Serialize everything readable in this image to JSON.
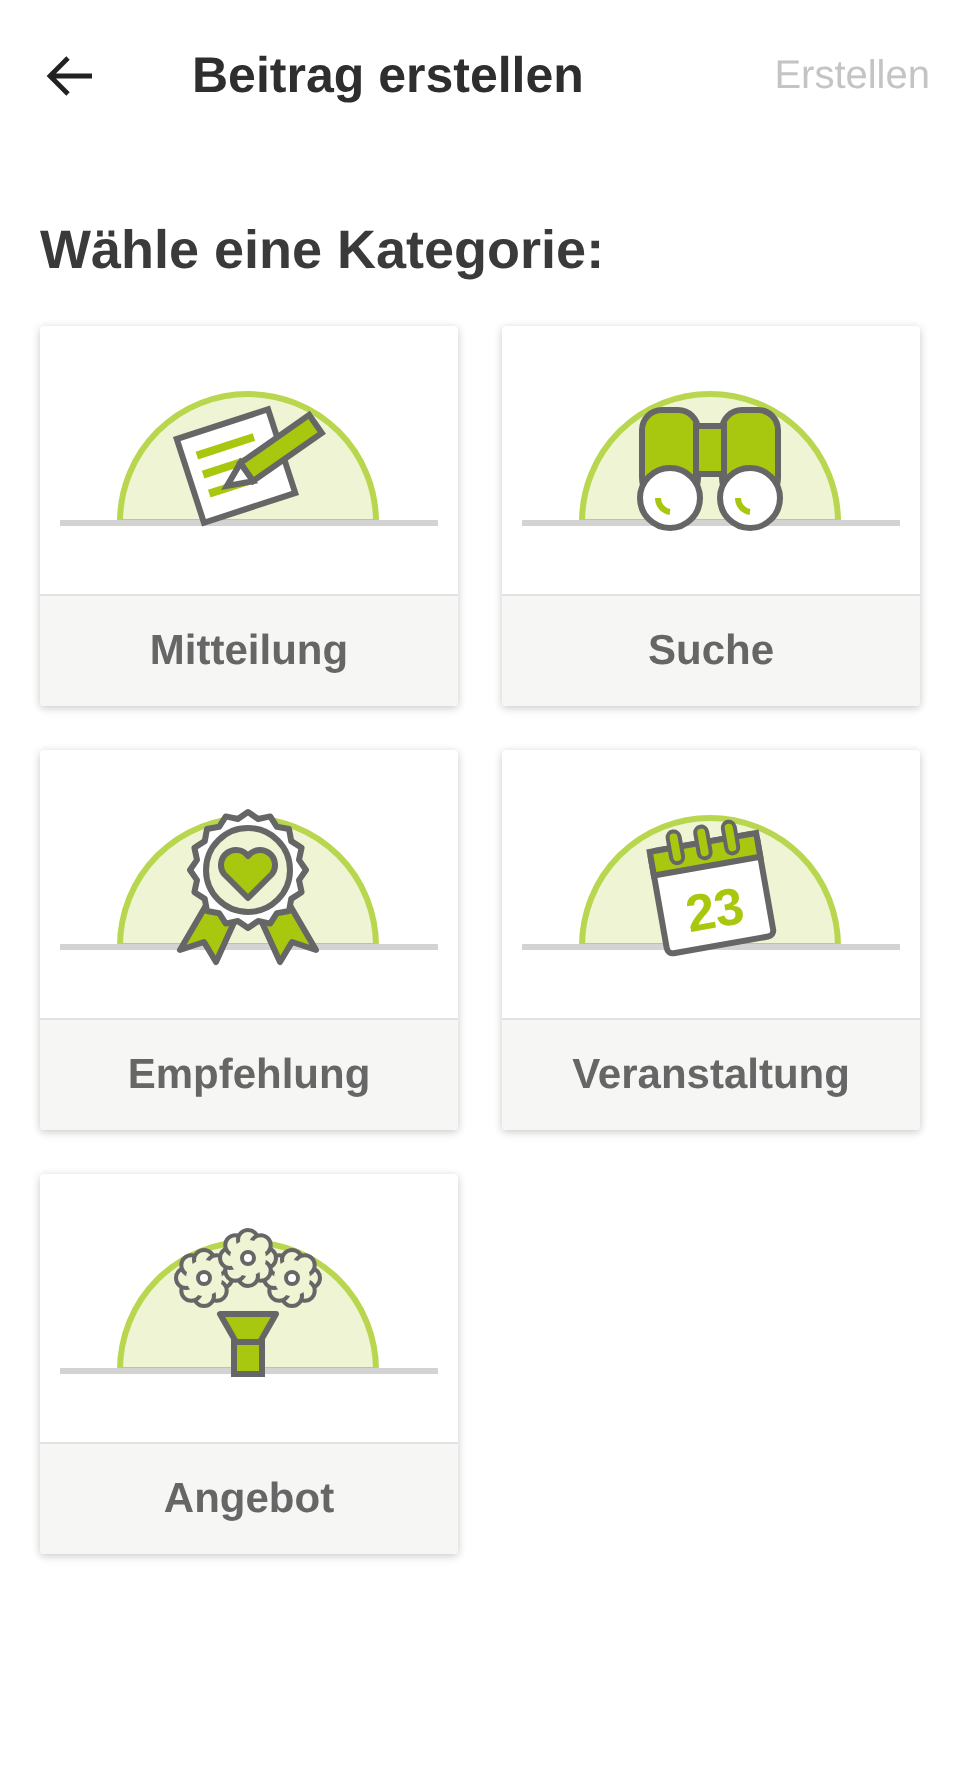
{
  "header": {
    "title": "Beitrag erstellen",
    "action": {
      "label": "Erstellen",
      "disabled": true
    }
  },
  "heading": "Wähle eine Kategorie:",
  "categories": [
    {
      "kind": "note",
      "label": "Mitteilung"
    },
    {
      "kind": "search",
      "label": "Suche"
    },
    {
      "kind": "award",
      "label": "Empfehlung"
    },
    {
      "kind": "calendar",
      "label": "Veranstaltung",
      "icon_text": "23"
    },
    {
      "kind": "flowers",
      "label": "Angebot"
    }
  ]
}
